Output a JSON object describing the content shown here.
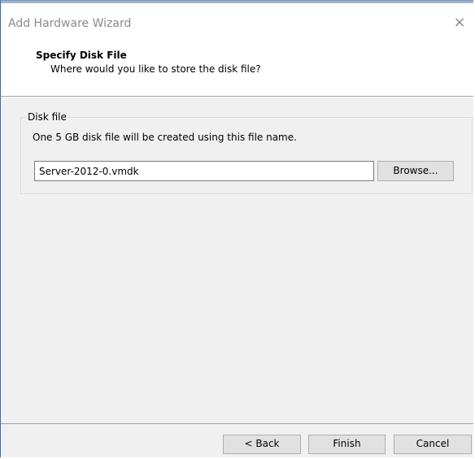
{
  "window": {
    "title": "Add Hardware Wizard",
    "close_label": "×"
  },
  "header": {
    "title": "Specify Disk File",
    "subtitle": "Where would you like to store the disk file?"
  },
  "disk_file_group": {
    "legend": "Disk file",
    "description": "One 5 GB disk file will be created using this file name.",
    "file_name_value": "Server-2012-0.vmdk",
    "browse_label": "Browse..."
  },
  "footer": {
    "back_label": "< Back",
    "finish_label": "Finish",
    "cancel_label": "Cancel"
  }
}
